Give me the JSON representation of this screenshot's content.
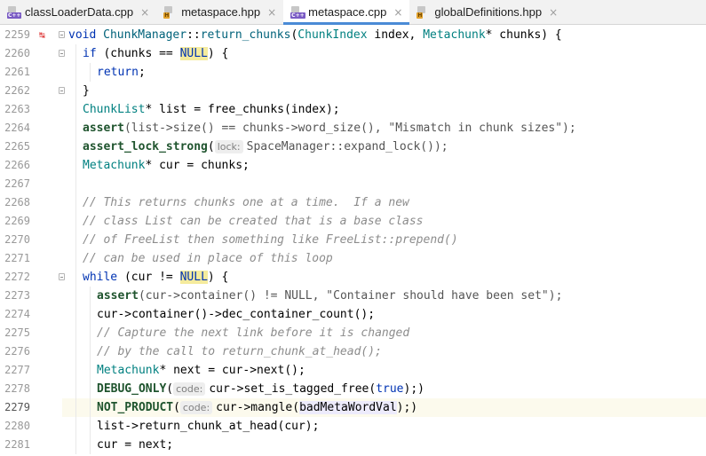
{
  "tabs": [
    {
      "label": "classLoaderData.cpp",
      "type": "cpp",
      "icon": "C++",
      "active": false
    },
    {
      "label": "metaspace.hpp",
      "type": "hpp",
      "icon": "H",
      "active": false
    },
    {
      "label": "metaspace.cpp",
      "type": "cpp",
      "icon": "C++",
      "active": true
    },
    {
      "label": "globalDefinitions.hpp",
      "type": "hpp",
      "icon": "H",
      "active": false
    }
  ],
  "close_glyph": "×",
  "editor": {
    "current_line": 2279,
    "override_marker_line": 2259,
    "override_marker_glyph": "↹",
    "fold_lines": [
      2259,
      2260,
      2262,
      2272
    ],
    "lines": [
      {
        "n": 2259,
        "indent": 0,
        "tokens": [
          [
            "kw",
            "void "
          ],
          [
            "fn",
            "ChunkManager"
          ],
          [
            "",
            "::"
          ],
          [
            "fn",
            "return_chunks"
          ],
          [
            "",
            "("
          ],
          [
            "ty",
            "ChunkIndex"
          ],
          [
            "",
            " index, "
          ],
          [
            "ty",
            "Metachunk"
          ],
          [
            "",
            "* chunks) {"
          ]
        ]
      },
      {
        "n": 2260,
        "indent": 1,
        "tokens": [
          [
            "kw",
            "if"
          ],
          [
            "",
            " (chunks == "
          ],
          [
            "nl",
            "NULL"
          ],
          [
            "",
            ") {"
          ]
        ]
      },
      {
        "n": 2261,
        "indent": 2,
        "tokens": [
          [
            "kw",
            "return"
          ],
          [
            "",
            ";"
          ]
        ]
      },
      {
        "n": 2262,
        "indent": 1,
        "tokens": [
          [
            "",
            "}"
          ]
        ]
      },
      {
        "n": 2263,
        "indent": 1,
        "tokens": [
          [
            "ty",
            "ChunkList"
          ],
          [
            "",
            "* list = free_chunks(index);"
          ]
        ]
      },
      {
        "n": 2264,
        "indent": 1,
        "tokens": [
          [
            "mac",
            "assert"
          ],
          [
            "gry",
            "(list->size() == chunks->word_size(), \"Mismatch in chunk sizes\");"
          ]
        ]
      },
      {
        "n": 2265,
        "indent": 1,
        "tokens": [
          [
            "mac",
            "assert_lock_strong"
          ],
          [
            "",
            "("
          ],
          [
            "hint",
            "lock:"
          ],
          [
            "gry",
            "SpaceManager::expand_lock());"
          ]
        ]
      },
      {
        "n": 2266,
        "indent": 1,
        "tokens": [
          [
            "ty",
            "Metachunk"
          ],
          [
            "",
            "* cur = chunks;"
          ]
        ]
      },
      {
        "n": 2267,
        "indent": 1,
        "tokens": []
      },
      {
        "n": 2268,
        "indent": 1,
        "tokens": [
          [
            "cm",
            "// This returns chunks one at a time.  If a new"
          ]
        ]
      },
      {
        "n": 2269,
        "indent": 1,
        "tokens": [
          [
            "cm",
            "// class List can be created that is a base class"
          ]
        ]
      },
      {
        "n": 2270,
        "indent": 1,
        "tokens": [
          [
            "cm",
            "// of FreeList then something like FreeList::prepend()"
          ]
        ]
      },
      {
        "n": 2271,
        "indent": 1,
        "tokens": [
          [
            "cm",
            "// can be used in place of this loop"
          ]
        ]
      },
      {
        "n": 2272,
        "indent": 1,
        "tokens": [
          [
            "kw",
            "while"
          ],
          [
            "",
            " (cur != "
          ],
          [
            "nl",
            "NULL"
          ],
          [
            "",
            ") {"
          ]
        ]
      },
      {
        "n": 2273,
        "indent": 2,
        "tokens": [
          [
            "mac",
            "assert"
          ],
          [
            "gry",
            "(cur->container() != NULL, \"Container should have been set\");"
          ]
        ]
      },
      {
        "n": 2274,
        "indent": 2,
        "tokens": [
          [
            "",
            "cur->container()->dec_container_count();"
          ]
        ]
      },
      {
        "n": 2275,
        "indent": 2,
        "tokens": [
          [
            "cm",
            "// Capture the next link before it is changed"
          ]
        ]
      },
      {
        "n": 2276,
        "indent": 2,
        "tokens": [
          [
            "cm",
            "// by the call to return_chunk_at_head();"
          ]
        ]
      },
      {
        "n": 2277,
        "indent": 2,
        "tokens": [
          [
            "ty",
            "Metachunk"
          ],
          [
            "",
            "* next = cur->next();"
          ]
        ]
      },
      {
        "n": 2278,
        "indent": 2,
        "tokens": [
          [
            "mac",
            "DEBUG_ONLY"
          ],
          [
            "",
            "("
          ],
          [
            "hint",
            "code:"
          ],
          [
            "",
            "cur->set_is_tagged_free("
          ],
          [
            "kw",
            "true"
          ],
          [
            "",
            ");)"
          ]
        ]
      },
      {
        "n": 2279,
        "indent": 2,
        "tokens": [
          [
            "mac",
            "NOT_PRODUCT"
          ],
          [
            "",
            "("
          ],
          [
            "hint",
            "code:"
          ],
          [
            "",
            "cur->mangle("
          ],
          [
            "hl",
            "badMetaWordVal"
          ],
          [
            "",
            ");)"
          ]
        ]
      },
      {
        "n": 2280,
        "indent": 2,
        "tokens": [
          [
            "",
            "list->return_chunk_at_head(cur);"
          ]
        ]
      },
      {
        "n": 2281,
        "indent": 2,
        "tokens": [
          [
            "",
            "cur = next;"
          ]
        ]
      }
    ]
  }
}
